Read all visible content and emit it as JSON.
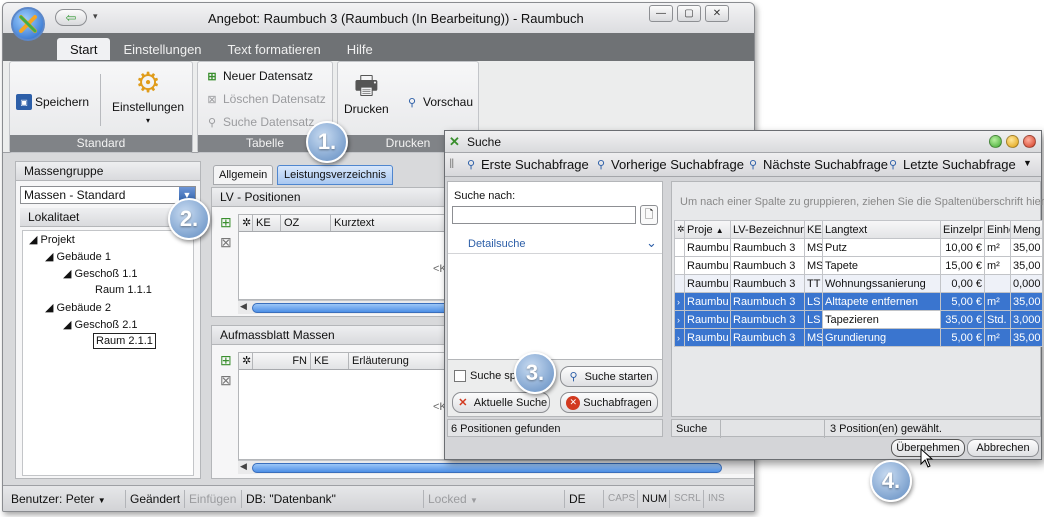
{
  "window": {
    "title": "Angebot: Raumbuch 3  (Raumbuch  (In Bearbeitung)) - Raumbuch"
  },
  "tabs": [
    "Start",
    "Einstellungen",
    "Text formatieren",
    "Hilfe"
  ],
  "ribbon": {
    "save": "Speichern",
    "settings": "Einstellungen",
    "new_record": "Neuer Datensatz",
    "delete_record": "Löschen Datensatz",
    "search_record": "Suche Datensatz",
    "print": "Drucken",
    "preview": "Vorschau",
    "groups": {
      "standard": "Standard",
      "table": "Tabelle",
      "print": "Drucken"
    }
  },
  "left": {
    "massengruppe_label": "Massengruppe",
    "massengruppe_value": "Massen - Standard",
    "lokalitaet_label": "Lokalitaet",
    "tree": {
      "projekt": "Projekt",
      "gebaeude1": "Gebäude 1",
      "geschoss11": "Geschoß 1.1",
      "raum111": "Raum 1.1.1",
      "gebaeude2": "Gebäude 2",
      "geschoss21": "Geschoß 2.1",
      "raum211": "Raum 2.1.1"
    }
  },
  "mid": {
    "tab_allgemein": "Allgemein",
    "tab_lv": "Leistungsverzeichnis",
    "lv_positionen": "LV - Positionen",
    "lv_cols": [
      "KE",
      "OZ",
      "Kurztext"
    ],
    "aufmass": "Aufmassblatt Massen",
    "aufmass_cols": [
      "FN",
      "KE",
      "Erläuterung"
    ],
    "cut_text": "<K"
  },
  "status": {
    "user": "Benutzer: Peter",
    "changed": "Geändert",
    "insert": "Einfügen",
    "db": "DB: \"Datenbank\"",
    "locked": "Locked",
    "lang": "DE",
    "caps": "CAPS",
    "num": "NUM",
    "scrl": "SCRL",
    "ins": "INS"
  },
  "dialog": {
    "title": "Suche",
    "toolbar": [
      "Erste Suchabfrage",
      "Vorherige Suchabfrage",
      "Nächste Suchabfrage",
      "Letzte Suchabfrage"
    ],
    "search_label": "Suche nach:",
    "detail": "Detailsuche",
    "save_search": "Suche spe",
    "start_search": "Suche starten",
    "current_search": "Aktuelle Suche",
    "queries": "Suchabfragen",
    "found": "6 Positionen gefunden",
    "group_hint": "Um nach einer Spalte zu gruppieren, ziehen Sie die Spaltenüberschrift hier",
    "columns": [
      "Proje",
      "LV-Bezeichnun",
      "KE",
      "Langtext",
      "Einzelpr",
      "Einhe",
      "Meng"
    ],
    "rows": [
      [
        "Raumbu",
        "Raumbuch 3",
        "MS",
        "Putz",
        "10,00 €",
        "m²",
        "35,00"
      ],
      [
        "Raumbu",
        "Raumbuch 3",
        "MS",
        "Tapete",
        "15,00 €",
        "m²",
        "35,00"
      ],
      [
        "Raumbu",
        "Raumbuch 3",
        "TT",
        "Wohnungssanierung",
        "0,00 €",
        "",
        "0,000"
      ],
      [
        "Raumbu",
        "Raumbuch 3",
        "LS",
        "Alttapete entfernen",
        "5,00 €",
        "m²",
        "35,00"
      ],
      [
        "Raumbu",
        "Raumbuch 3",
        "LS",
        "Tapezieren",
        "35,00 €",
        "Std.",
        "3,000"
      ],
      [
        "Raumbu",
        "Raumbuch 3",
        "MS",
        "Grundierung",
        "5,00 €",
        "m²",
        "35,00"
      ]
    ],
    "status_left": "Suche",
    "selected": "3 Position(en) gewählt.",
    "apply": "Übernehmen",
    "cancel": "Abbrechen"
  },
  "callouts": [
    "1.",
    "2.",
    "3.",
    "4."
  ]
}
